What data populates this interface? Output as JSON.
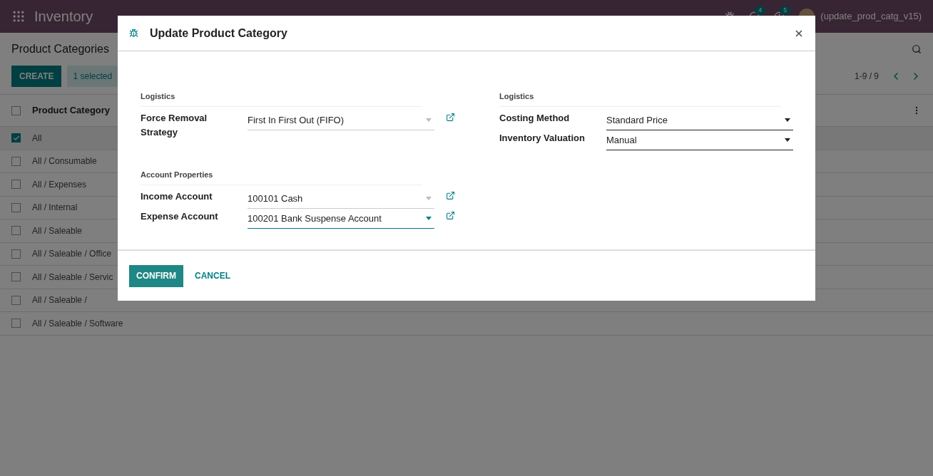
{
  "navbar": {
    "app_name": "Inventory",
    "messages_count": "4",
    "activities_count": "5",
    "user": "(update_prod_catg_v15)"
  },
  "control_panel": {
    "title": "Product Categories",
    "create": "CREATE",
    "selection": "1 selected",
    "pager": "1-9 / 9"
  },
  "table": {
    "column": "Product Category",
    "all_checked": false,
    "rows": [
      {
        "label": "All",
        "checked": true
      },
      {
        "label": "All / Consumable",
        "checked": false
      },
      {
        "label": "All / Expenses",
        "checked": false
      },
      {
        "label": "All / Internal",
        "checked": false
      },
      {
        "label": "All / Saleable",
        "checked": false
      },
      {
        "label": "All / Saleable / Office",
        "checked": false
      },
      {
        "label": "All / Saleable / Servic",
        "checked": false
      },
      {
        "label": "All / Saleable /",
        "checked": false
      },
      {
        "label": "All / Saleable / Software",
        "checked": false
      }
    ]
  },
  "dialog": {
    "title": "Update Product Category",
    "columns": [
      [
        {
          "heading": "Logistics",
          "fields": [
            {
              "label": "Force Removal Strategy",
              "value": "First In First Out (FIFO)",
              "kind": "many2one",
              "focused": false
            }
          ]
        },
        {
          "heading": "Account Properties",
          "fields": [
            {
              "label": "Income Account",
              "value": "100101 Cash",
              "kind": "many2one",
              "focused": false
            },
            {
              "label": "Expense Account",
              "value": "100201 Bank Suspense Account",
              "kind": "many2one",
              "focused": true
            }
          ]
        }
      ],
      [
        {
          "heading": "Logistics",
          "fields": [
            {
              "label": "Costing Method",
              "value": "Standard Price",
              "kind": "select",
              "focused": false
            },
            {
              "label": "Inventory Valuation",
              "value": "Manual",
              "kind": "select",
              "focused": false
            }
          ]
        }
      ]
    ],
    "confirm": "CONFIRM",
    "cancel": "CANCEL"
  }
}
